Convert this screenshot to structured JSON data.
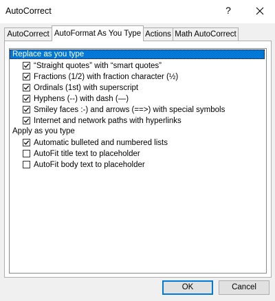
{
  "window": {
    "title": "AutoCorrect",
    "help_glyph": "?"
  },
  "tabs": [
    {
      "label": "AutoCorrect",
      "active": false
    },
    {
      "label": "AutoFormat As You Type",
      "active": true
    },
    {
      "label": "Actions",
      "active": false
    },
    {
      "label": "Math AutoCorrect",
      "active": false
    }
  ],
  "groups": [
    {
      "label": "Replace as you type",
      "selected": true,
      "items": [
        {
          "label": "“Straight quotes” with “smart quotes”",
          "checked": true
        },
        {
          "label": "Fractions (1/2) with fraction character (½)",
          "checked": true
        },
        {
          "label": "Ordinals (1st) with superscript",
          "checked": true
        },
        {
          "label": "Hyphens (--) with dash (—)",
          "checked": true
        },
        {
          "label": "Smiley faces :-) and arrows (==>) with special symbols",
          "checked": true
        },
        {
          "label": "Internet and network paths with hyperlinks",
          "checked": true
        }
      ]
    },
    {
      "label": "Apply as you type",
      "selected": false,
      "items": [
        {
          "label": "Automatic bulleted and numbered lists",
          "checked": true
        },
        {
          "label": "AutoFit title text to placeholder",
          "checked": false
        },
        {
          "label": "AutoFit body text to placeholder",
          "checked": false
        }
      ]
    }
  ],
  "buttons": {
    "ok_label": "OK",
    "cancel_label": "Cancel"
  },
  "colors": {
    "selection": "#0078d7",
    "dialog_bg": "#f0f0f0"
  }
}
